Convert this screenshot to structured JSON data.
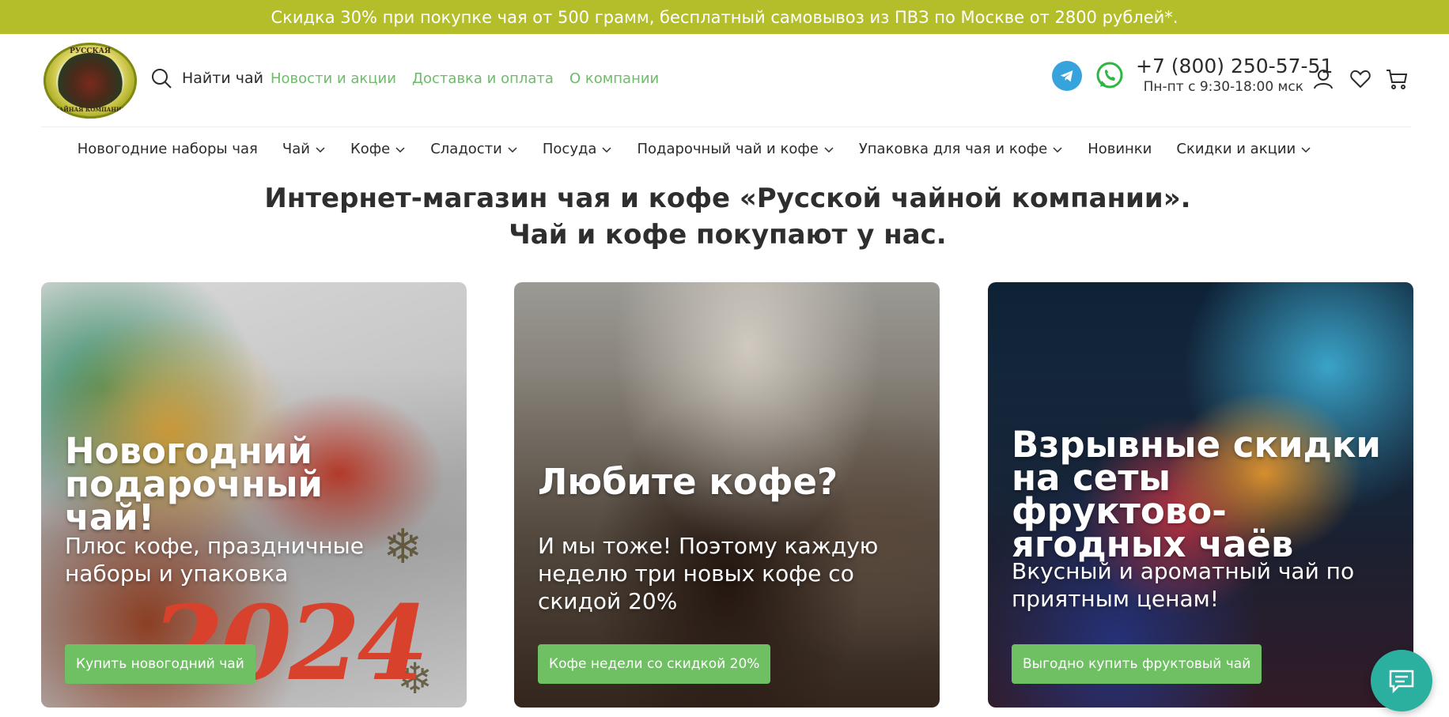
{
  "promo": {
    "text": "Скидка 30% при покупке чая от 500 грамм, бесплатный самовывоз из ПВЗ по Москве от 2800 рублей*."
  },
  "header": {
    "logo_text_top": "РУССКАЯ",
    "logo_text_bottom": "ЧАЙНАЯ КОМПАНИЯ",
    "search_label": "Найти чай",
    "links": [
      "Новости и акции",
      "Доставка и оплата",
      "О компании"
    ],
    "phone": "+7 (800) 250-57-51",
    "hours": "Пн-пт с 9:30-18:00 мск"
  },
  "nav": {
    "items": [
      {
        "label": "Новогодние наборы чая",
        "dropdown": false
      },
      {
        "label": "Чай",
        "dropdown": true
      },
      {
        "label": "Кофе",
        "dropdown": true
      },
      {
        "label": "Сладости",
        "dropdown": true
      },
      {
        "label": "Посуда",
        "dropdown": true
      },
      {
        "label": "Подарочный чай и кофе",
        "dropdown": true
      },
      {
        "label": "Упаковка для чая и кофе",
        "dropdown": true
      },
      {
        "label": "Новинки",
        "dropdown": false
      },
      {
        "label": "Скидки и акции",
        "dropdown": true
      }
    ]
  },
  "main": {
    "title_line1": "Интернет-магазин чая и кофе «Русской чайной компании».",
    "title_line2": "Чай и кофе покупают у нас.",
    "cards": [
      {
        "title": "Новогодний подарочный чай!",
        "text": "Плюс кофе, праздничные наборы и упаковка",
        "button": "Купить новогодний чай",
        "image_text": "2024"
      },
      {
        "title": "Любите кофе?",
        "text": "И мы тоже! Поэтому каждую неделю три новых кофе со скидой 20%",
        "button": "Кофе недели со скидкой 20%"
      },
      {
        "title": "Взрывные скидки на сеты фруктово-ягодных чаёв",
        "text": "Вкусный и ароматный чай по приятным ценам!",
        "button": "Выгодно купить фруктовый чай"
      }
    ]
  },
  "colors": {
    "promo_bg": "#b3be2a",
    "link_green": "#6fbb6b",
    "button_green": "#6fbf63",
    "telegram": "#37a3dd",
    "whatsapp": "#2db742",
    "chat": "#2bb0a0"
  },
  "icons": [
    "search-icon",
    "telegram-icon",
    "whatsapp-icon",
    "user-icon",
    "heart-icon",
    "cart-icon",
    "chevron-down-icon",
    "chat-icon",
    "snowflake-icon"
  ]
}
